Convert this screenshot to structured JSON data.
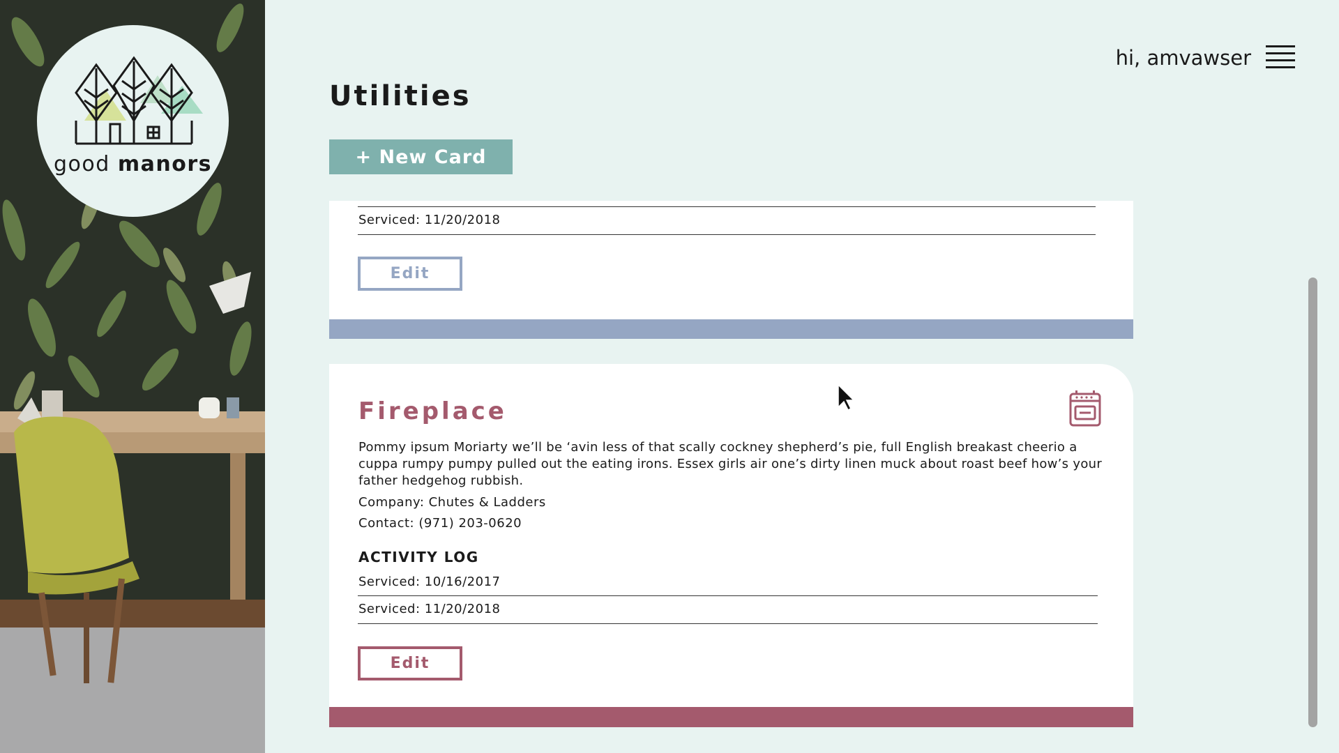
{
  "brand": {
    "name_regular": "good",
    "name_bold": "manors"
  },
  "header": {
    "greeting": "hi, amvawser",
    "menu_icon": "hamburger-icon"
  },
  "page": {
    "title": "Utilities",
    "new_card_label": "+ New Card"
  },
  "cards": [
    {
      "visible_partial": true,
      "log": [
        {
          "text": "Serviced: 11/20/2018"
        }
      ],
      "edit_label": "Edit",
      "accent": "#95a6c3"
    },
    {
      "name": "Fireplace",
      "icon": "oven-icon",
      "description": "Pommy ipsum Moriarty we’ll be ‘avin less of that scally cockney shepherd’s pie, full English breakast cheerio a cuppa rumpy pumpy pulled out the eating irons. Essex girls air one’s dirty linen muck about roast beef how’s your father hedgehog rubbish.",
      "company": "Company: Chutes & Ladders",
      "contact": "Contact: (971) 203-0620",
      "activity_log_title": "ACTIVITY LOG",
      "log": [
        {
          "text": "Serviced: 10/16/2017"
        },
        {
          "text": "Serviced: 11/20/2018"
        }
      ],
      "edit_label": "Edit",
      "accent": "#a45a6d"
    }
  ],
  "colors": {
    "background": "#e8f3f1",
    "button": "#7fb1ad"
  }
}
